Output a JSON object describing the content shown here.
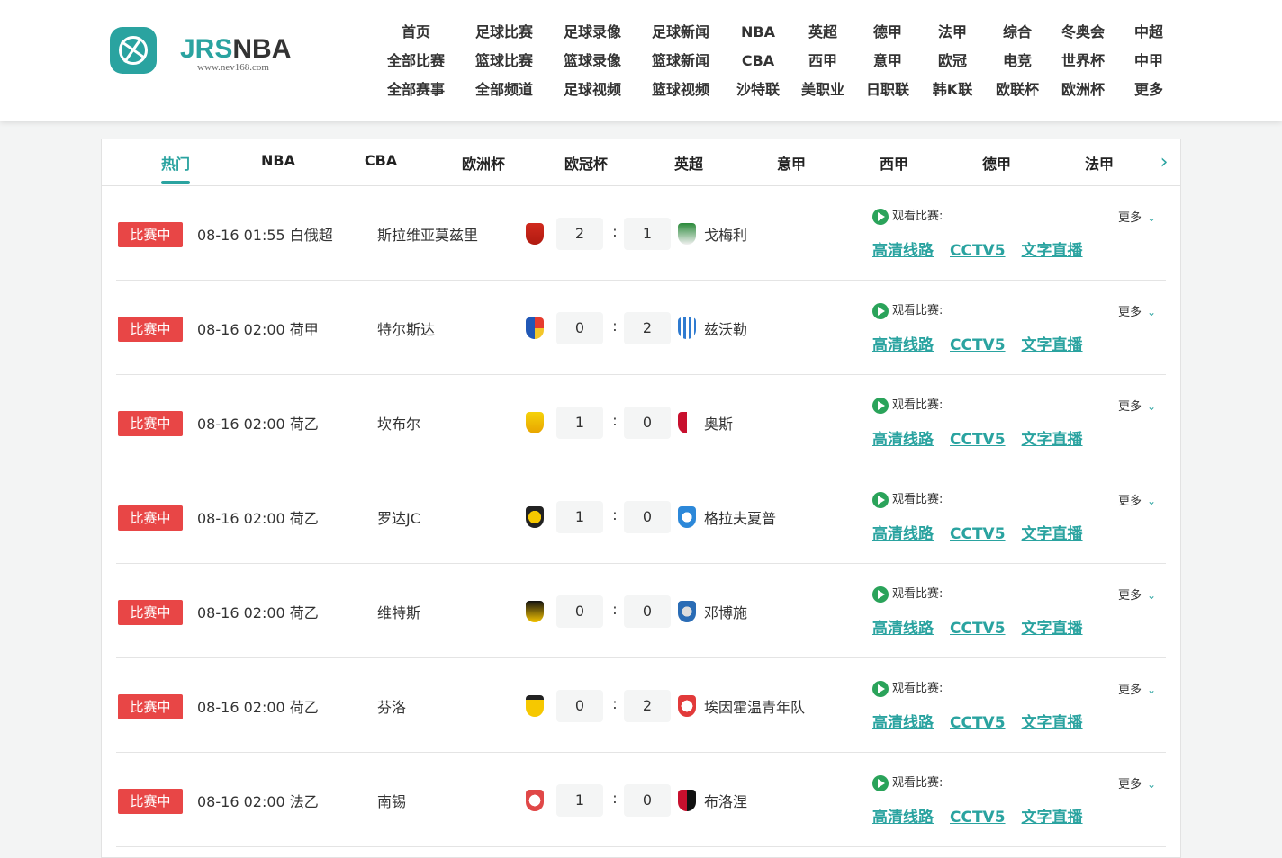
{
  "brand": {
    "name_part1": "JRS",
    "name_part2": "NBA",
    "subtitle": "www.nev168.com"
  },
  "topnav": [
    [
      "首页",
      "全部比赛",
      "全部赛事"
    ],
    [
      "足球比赛",
      "篮球比赛",
      "全部频道"
    ],
    [
      "足球录像",
      "篮球录像",
      "足球视频"
    ],
    [
      "足球新闻",
      "篮球新闻",
      "篮球视频"
    ],
    [
      "NBA",
      "CBA",
      "沙特联"
    ],
    [
      "英超",
      "西甲",
      "美职业"
    ],
    [
      "德甲",
      "意甲",
      "日职联"
    ],
    [
      "法甲",
      "欧冠",
      "韩K联"
    ],
    [
      "综合",
      "电竞",
      "欧联杯"
    ],
    [
      "冬奥会",
      "世界杯",
      "欧洲杯"
    ],
    [
      "中超",
      "中甲",
      "更多"
    ]
  ],
  "tabs": [
    "热门",
    "NBA",
    "CBA",
    "欧洲杯",
    "欧冠杯",
    "英超",
    "意甲",
    "西甲",
    "德甲",
    "法甲"
  ],
  "active_tab": "热门",
  "status_label": "比赛中",
  "watch_label": "观看比赛:",
  "more_label": "更多",
  "links": [
    "高清线路",
    "CCTV5",
    "文字直播"
  ],
  "matches": [
    {
      "time": "08-16 01:55",
      "league": "白俄超",
      "home": "斯拉维亚莫兹里",
      "home_score": "2",
      "away_score": "1",
      "away": "戈梅利"
    },
    {
      "time": "08-16 02:00",
      "league": "荷甲",
      "home": "特尔斯达",
      "home_score": "0",
      "away_score": "2",
      "away": "兹沃勒"
    },
    {
      "time": "08-16 02:00",
      "league": "荷乙",
      "home": "坎布尔",
      "home_score": "1",
      "away_score": "0",
      "away": "奥斯"
    },
    {
      "time": "08-16 02:00",
      "league": "荷乙",
      "home": "罗达JC",
      "home_score": "1",
      "away_score": "0",
      "away": "格拉夫夏普"
    },
    {
      "time": "08-16 02:00",
      "league": "荷乙",
      "home": "维特斯",
      "home_score": "0",
      "away_score": "0",
      "away": "邓博施"
    },
    {
      "time": "08-16 02:00",
      "league": "荷乙",
      "home": "芬洛",
      "home_score": "0",
      "away_score": "2",
      "away": "埃因霍温青年队"
    },
    {
      "time": "08-16 02:00",
      "league": "法乙",
      "home": "南锡",
      "home_score": "1",
      "away_score": "0",
      "away": "布洛涅"
    }
  ],
  "colors": {
    "accent": "#2aa3a0",
    "live_badge": "#e84646",
    "watch_icon": "#2aa35a"
  }
}
